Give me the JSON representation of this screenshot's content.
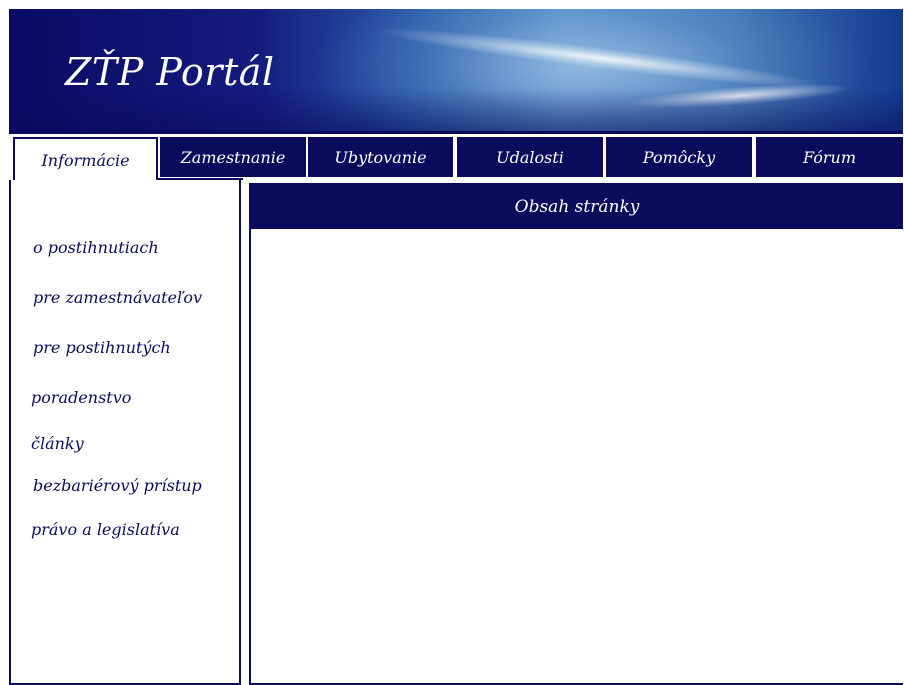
{
  "header": {
    "title": "ZŤP Portál"
  },
  "nav": {
    "tabs": [
      {
        "label": "Informácie",
        "active": true
      },
      {
        "label": "Zamestnanie",
        "active": false
      },
      {
        "label": "Ubytovanie",
        "active": false
      },
      {
        "label": "Udalosti",
        "active": false
      },
      {
        "label": "Pomôcky",
        "active": false
      },
      {
        "label": "Fórum",
        "active": false
      }
    ]
  },
  "sidebar": {
    "links": [
      "o postihnutiach",
      "pre zamestnávateľov",
      "pre postihnutých",
      "poradenstvo",
      "články",
      "bezbariérový prístup",
      "právo a legislatíva"
    ]
  },
  "main": {
    "heading": "Obsah stránky"
  },
  "colors": {
    "primary": "#0b0b5e",
    "background": "#ffffff"
  }
}
